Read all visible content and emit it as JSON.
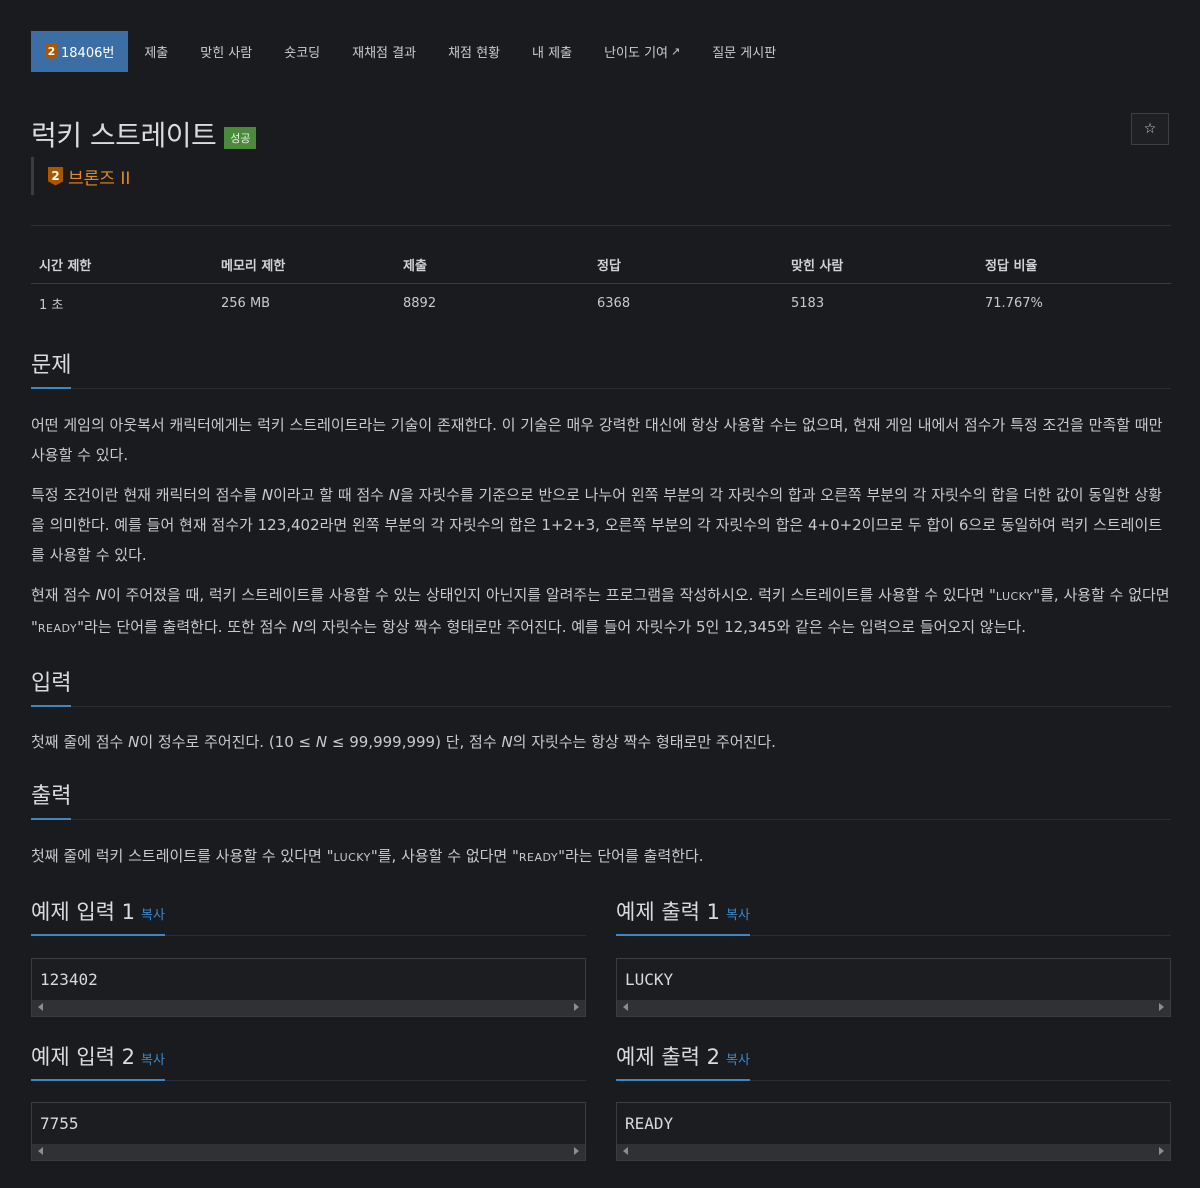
{
  "tabs": {
    "problem_number": "18406번",
    "tier_digit": "2",
    "items": [
      "제출",
      "맞힌 사람",
      "숏코딩",
      "재채점 결과",
      "채점 현황",
      "내 제출",
      "난이도 기여",
      "질문 게시판"
    ]
  },
  "problem": {
    "title": "럭키 스트레이트",
    "status_badge": "성공",
    "tier_digit": "2",
    "tier_label": "브론즈 II",
    "star_icon": "star-icon"
  },
  "stats": {
    "headers": [
      "시간 제한",
      "메모리 제한",
      "제출",
      "정답",
      "맞힌 사람",
      "정답 비율"
    ],
    "values": [
      "1 초",
      "256 MB",
      "8892",
      "6368",
      "5183",
      "71.767%"
    ]
  },
  "sections": {
    "problem_heading": "문제",
    "input_heading": "입력",
    "output_heading": "출력"
  },
  "description": {
    "p1": "어떤 게임의 아웃복서 캐릭터에게는 럭키 스트레이트라는 기술이 존재한다. 이 기술은 매우 강력한 대신에 항상 사용할 수는 없으며, 현재 게임 내에서 점수가 특정 조건을 만족할 때만 사용할 수 있다.",
    "p2_a": "특정 조건이란 현재 캐릭터의 점수를 ",
    "p2_n1": "N",
    "p2_b": "이라고 할 때 점수 ",
    "p2_n2": "N",
    "p2_c": "을 자릿수를 기준으로 반으로 나누어 왼쪽 부분의 각 자릿수의 합과 오른쪽 부분의 각 자릿수의 합을 더한 값이 동일한 상황을 의미한다. 예를 들어 현재 점수가 123,402라면 왼쪽 부분의 각 자릿수의 합은 1+2+3, 오른쪽 부분의 각 자릿수의 합은 4+0+2이므로 두 합이 6으로 동일하여 럭키 스트레이트를 사용할 수 있다.",
    "p3_a": "현재 점수 ",
    "p3_n1": "N",
    "p3_b": "이 주어졌을 때, 럭키 스트레이트를 사용할 수 있는 상태인지 아닌지를 알려주는 프로그램을 작성하시오. 럭키 스트레이트를 사용할 수 있다면 \"",
    "p3_lucky": "LUCKY",
    "p3_c": "\"를, 사용할 수 없다면 \"",
    "p3_ready": "READY",
    "p3_d": "\"라는 단어를 출력한다. 또한 점수 ",
    "p3_n2": "N",
    "p3_e": "의 자릿수는 항상 짝수 형태로만 주어진다. 예를 들어 자릿수가 5인 12,345와 같은 수는 입력으로 들어오지 않는다."
  },
  "input": {
    "a": "첫째 줄에 점수 ",
    "n1": "N",
    "b": "이 정수로 주어진다. (10 ≤ ",
    "n2": "N",
    "c": " ≤ 99,999,999) 단, 점수 ",
    "n3": "N",
    "d": "의 자릿수는 항상 짝수 형태로만 주어진다."
  },
  "output": {
    "a": "첫째 줄에 럭키 스트레이트를 사용할 수 있다면 \"",
    "lucky": "LUCKY",
    "b": "\"를, 사용할 수 없다면 \"",
    "ready": "READY",
    "c": "\"라는 단어를 출력한다."
  },
  "samples": {
    "copy_label": "복사",
    "in1_title": "예제 입력 1",
    "in1_value": "123402",
    "out1_title": "예제 출력 1",
    "out1_value": "LUCKY",
    "in2_title": "예제 입력 2",
    "in2_value": "7755",
    "out2_title": "예제 출력 2",
    "out2_value": "READY"
  },
  "colors": {
    "background": "#1a1b1e",
    "active_tab": "#3b6ea5",
    "accent_blue": "#3b87c8",
    "success_green": "#4a8a3a",
    "bronze": "#ad5600"
  }
}
